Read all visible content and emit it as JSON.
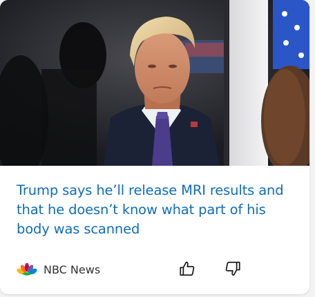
{
  "card": {
    "headline": "Trump says he’ll release MRI results and that he doesn’t know what part of his body was scanned",
    "source": {
      "name": "NBC News",
      "logo_icon": "nbc-peacock-icon"
    },
    "actions": {
      "like_icon": "thumbs-up-icon",
      "dislike_icon": "thumbs-down-icon"
    },
    "image_icon": "news-photo"
  },
  "colors": {
    "accent": "#0f6cbd",
    "source_text": "#333333",
    "card_bg": "#ffffff",
    "page_bg": "#f3f3f3"
  }
}
